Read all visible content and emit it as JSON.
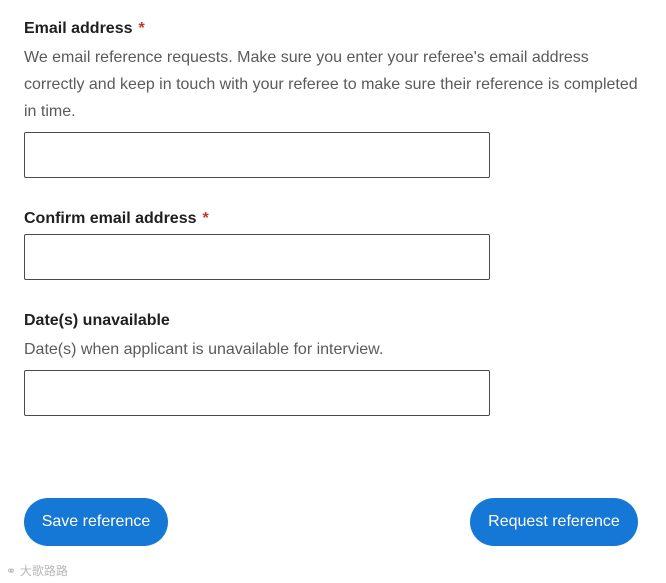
{
  "email": {
    "label": "Email address",
    "required_marker": "*",
    "hint": "We email reference requests. Make sure you enter your referee's email address correctly and keep in touch with your referee to make sure their reference is completed in time.",
    "value": ""
  },
  "confirm_email": {
    "label": "Confirm email address",
    "required_marker": "*",
    "value": ""
  },
  "dates_unavailable": {
    "label": "Date(s) unavailable",
    "hint": "Date(s) when applicant is unavailable for interview.",
    "value": ""
  },
  "actions": {
    "save_label": "Save reference",
    "request_label": "Request reference"
  },
  "watermark": {
    "text": "大歌路路"
  },
  "colors": {
    "button_bg": "#1578d6",
    "required_marker": "#c0392b",
    "field_border": "#4a4a4a"
  }
}
